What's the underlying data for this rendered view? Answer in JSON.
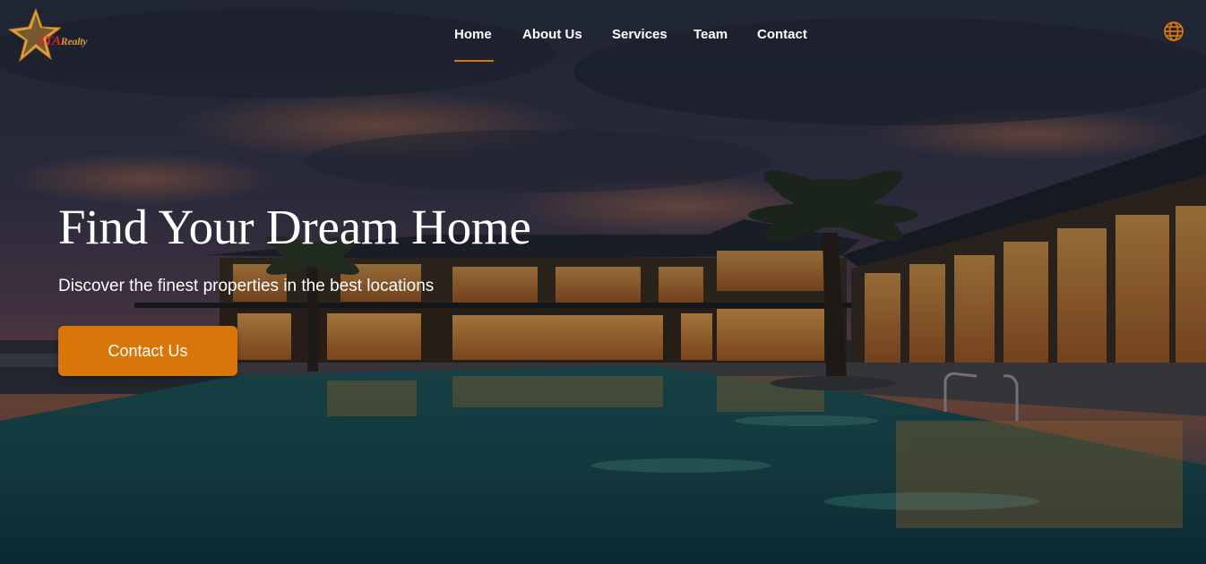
{
  "brand": {
    "logo_primary": "STA",
    "logo_secondary": "Realty"
  },
  "nav": {
    "items": [
      {
        "label": "Home",
        "active": true
      },
      {
        "label": "About Us",
        "active": false
      },
      {
        "label": "Services",
        "active": false
      },
      {
        "label": "Team",
        "active": false
      },
      {
        "label": "Contact",
        "active": false
      }
    ]
  },
  "hero": {
    "title": "Find Your Dream Home",
    "subtitle": "Discover the finest properties in the best locations",
    "cta_label": "Contact Us"
  },
  "icons": {
    "language": "globe-icon",
    "logo_mark": "star-icon"
  },
  "colors": {
    "accent": "#d9760a",
    "logo_red": "#d4262a",
    "logo_gold": "#d89440",
    "text": "#ffffff"
  }
}
